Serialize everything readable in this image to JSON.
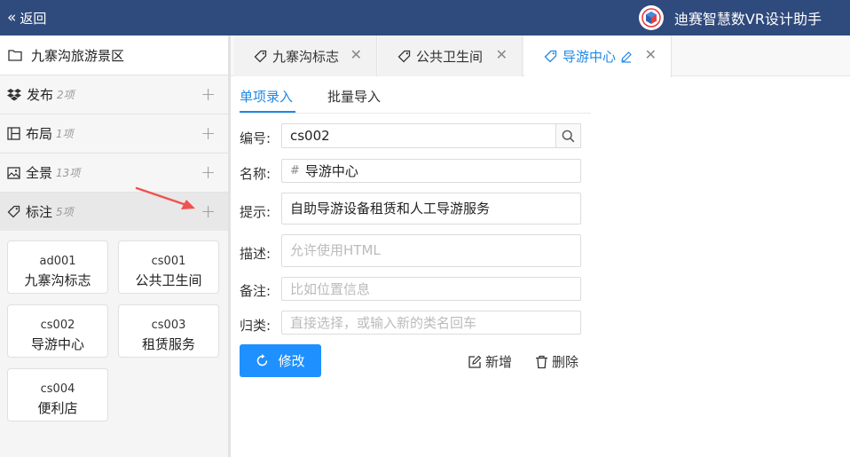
{
  "header": {
    "back_label": "返回",
    "app_title": "迪赛智慧数VR设计助手"
  },
  "sidebar": {
    "project_name": "九寨沟旅游景区",
    "sections": [
      {
        "name": "发布",
        "count": "2项"
      },
      {
        "name": "布局",
        "count": "1项"
      },
      {
        "name": "全景",
        "count": "13项"
      },
      {
        "name": "标注",
        "count": "5项"
      }
    ],
    "cards": [
      {
        "code": "ad001",
        "name": "九寨沟标志"
      },
      {
        "code": "cs001",
        "name": "公共卫生间"
      },
      {
        "code": "cs002",
        "name": "导游中心"
      },
      {
        "code": "cs003",
        "name": "租赁服务"
      },
      {
        "code": "cs004",
        "name": "便利店"
      }
    ]
  },
  "tabs": [
    {
      "label": "九寨沟标志"
    },
    {
      "label": "公共卫生间"
    },
    {
      "label": "导游中心"
    }
  ],
  "subtabs": {
    "single": "单项录入",
    "batch": "批量导入"
  },
  "form": {
    "id_label": "编号:",
    "id_value": "cs002",
    "name_label": "名称:",
    "name_hash": "#",
    "name_value": "导游中心",
    "tip_label": "提示:",
    "tip_value": "自助导游设备租赁和人工导游服务",
    "desc_label": "描述:",
    "desc_placeholder": "允许使用HTML",
    "note_label": "备注:",
    "note_placeholder": "比如位置信息",
    "category_label": "归类:",
    "category_placeholder": "直接选择，或输入新的类名回车"
  },
  "actions": {
    "modify": "修改",
    "add": "新增",
    "delete": "删除"
  },
  "colors": {
    "header_bg": "#2f4a7c",
    "accent": "#1e88e5",
    "button_bg": "#1e90ff",
    "annotation_arrow": "#f0524f"
  }
}
